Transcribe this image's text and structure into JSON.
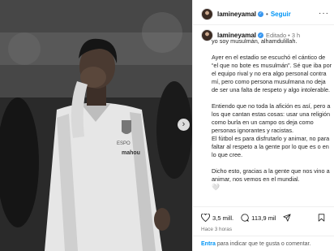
{
  "post": {
    "username": "lamineyamal",
    "follow_label": "Seguir",
    "edited_label": "Editado",
    "relative_time": "3 h",
    "caption_lines": "yo soy musulmán, alhamdulillah.\n\nAyer en el estadio se escuchó el cántico de “el que no bote es musulmán”. Sé que iba por el equipo rival y no era algo personal contra mí, pero como persona musulmana no deja de ser una falta de respeto y algo intolerable.\n\nEntiendo que no toda la afición es así, pero a los que cantan estas cosas: usar una religión como burla en un campo os deja como personas ignorantes y racistas.\nEl fútbol es para disfrutarlo y animar, no para faltar al respeto a la gente por lo que es o en lo que cree.\n\nDicho esto, gracias a la gente que nos vino a animar, nos vemos en el mundial.",
    "caption_emoji": "🤍",
    "likes": "3,5 mill.",
    "comments": "113,9 mil",
    "posted_time": "Hace 3 horas",
    "login_link": "Entra",
    "login_text": " para indicar que te gusta o comentar."
  },
  "photo": {
    "shirt_brand": "mahou",
    "crest_text": "ESPO",
    "description_icon": "player-photo"
  },
  "colors": {
    "accent": "#0095f6",
    "verified": "#3897f0",
    "muted": "#737373"
  }
}
